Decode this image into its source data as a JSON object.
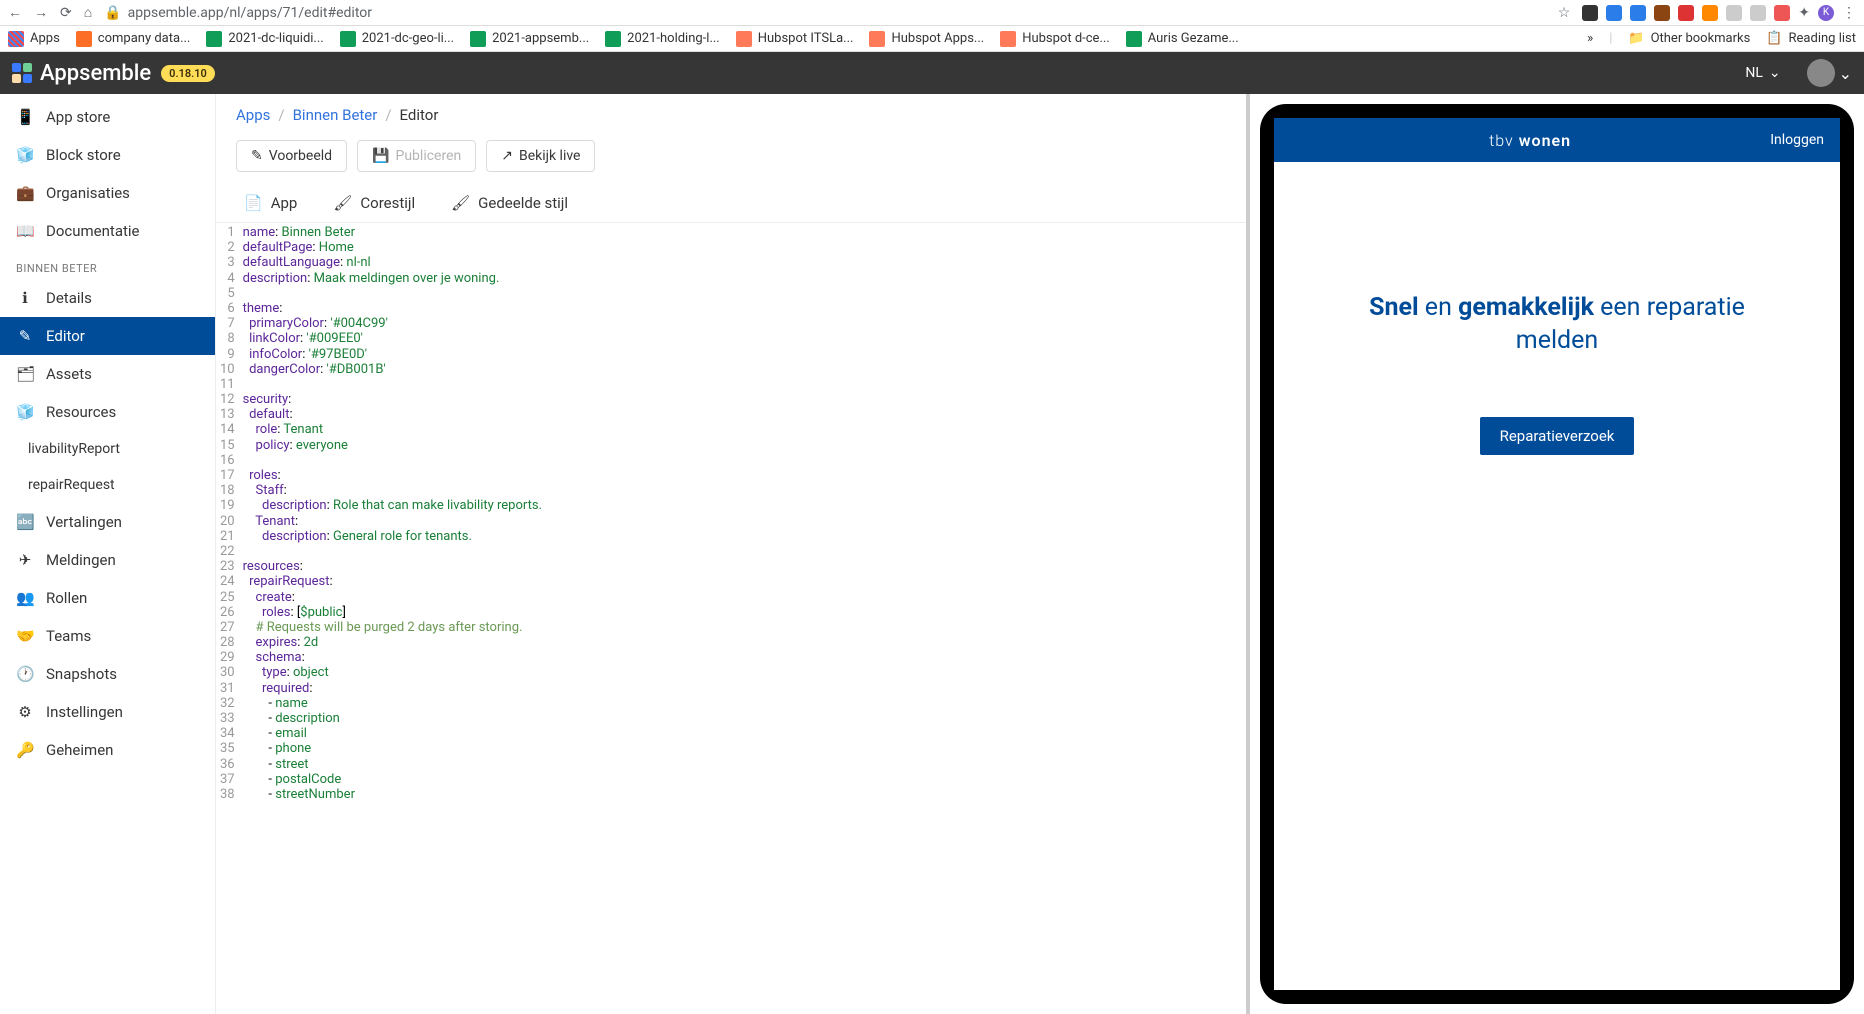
{
  "browser": {
    "url": "appsemble.app/nl/apps/71/edit#editor",
    "bookmarks": [
      "Apps",
      "company data...",
      "2021-dc-liquidi...",
      "2021-dc-geo-li...",
      "2021-appsemb...",
      "2021-holding-l...",
      "Hubspot ITSLa...",
      "Hubspot Apps...",
      "Hubspot d-ce...",
      "Auris Gezame..."
    ],
    "bookmarks_overflow": "»",
    "other_bookmarks": "Other bookmarks",
    "reading_list": "Reading list"
  },
  "header": {
    "brand": "Appsemble",
    "version": "0.18.10",
    "lang": "NL"
  },
  "sidebar": {
    "items": [
      {
        "label": "App store"
      },
      {
        "label": "Block store"
      },
      {
        "label": "Organisaties"
      },
      {
        "label": "Documentatie"
      }
    ],
    "section": "BINNEN BETER",
    "app_items": [
      {
        "label": "Details"
      },
      {
        "label": "Editor"
      },
      {
        "label": "Assets"
      },
      {
        "label": "Resources"
      }
    ],
    "resources": [
      "livabilityReport",
      "repairRequest"
    ],
    "more_items": [
      {
        "label": "Vertalingen"
      },
      {
        "label": "Meldingen"
      },
      {
        "label": "Rollen"
      },
      {
        "label": "Teams"
      },
      {
        "label": "Snapshots"
      },
      {
        "label": "Instellingen"
      },
      {
        "label": "Geheimen"
      }
    ]
  },
  "breadcrumb": {
    "apps": "Apps",
    "app": "Binnen Beter",
    "page": "Editor"
  },
  "toolbar": {
    "preview": "Voorbeeld",
    "publish": "Publiceren",
    "view_live": "Bekijk live"
  },
  "tabs": {
    "app": "App",
    "corestyle": "Corestijl",
    "sharedstyle": "Gedeelde stijl"
  },
  "code": {
    "lines": [
      {
        "n": 1,
        "t": "<span class='k-key'>name</span>: <span class='k-str'>Binnen Beter</span>"
      },
      {
        "n": 2,
        "t": "<span class='k-key'>defaultPage</span>: <span class='k-str'>Home</span>"
      },
      {
        "n": 3,
        "t": "<span class='k-key'>defaultLanguage</span>: <span class='k-str'>nl-nl</span>"
      },
      {
        "n": 4,
        "t": "<span class='k-key'>description</span>: <span class='k-str'>Maak meldingen over je woning.</span>"
      },
      {
        "n": 5,
        "t": ""
      },
      {
        "n": 6,
        "t": "<span class='k-key'>theme</span>:"
      },
      {
        "n": 7,
        "t": "  <span class='k-key'>primaryColor</span>: <span class='k-str'>'#004C99'</span>"
      },
      {
        "n": 8,
        "t": "  <span class='k-key'>linkColor</span>: <span class='k-str'>'#009EE0'</span>"
      },
      {
        "n": 9,
        "t": "  <span class='k-key'>infoColor</span>: <span class='k-str'>'#97BE0D'</span>"
      },
      {
        "n": 10,
        "t": "  <span class='k-key'>dangerColor</span>: <span class='k-str'>'#DB001B'</span>"
      },
      {
        "n": 11,
        "t": ""
      },
      {
        "n": 12,
        "t": "<span class='k-key'>security</span>:"
      },
      {
        "n": 13,
        "t": "  <span class='k-key'>default</span>:"
      },
      {
        "n": 14,
        "t": "    <span class='k-key'>role</span>: <span class='k-str'>Tenant</span>"
      },
      {
        "n": 15,
        "t": "    <span class='k-key'>policy</span>: <span class='k-str'>everyone</span>"
      },
      {
        "n": 16,
        "t": ""
      },
      {
        "n": 17,
        "t": "  <span class='k-key'>roles</span>:"
      },
      {
        "n": 18,
        "t": "    <span class='k-key'>Staff</span>:"
      },
      {
        "n": 19,
        "t": "      <span class='k-key'>description</span>: <span class='k-str'>Role that can make livability reports.</span>"
      },
      {
        "n": 20,
        "t": "    <span class='k-key'>Tenant</span>:"
      },
      {
        "n": 21,
        "t": "      <span class='k-key'>description</span>: <span class='k-str'>General role for tenants.</span>"
      },
      {
        "n": 22,
        "t": ""
      },
      {
        "n": 23,
        "t": "<span class='k-key'>resources</span>:"
      },
      {
        "n": 24,
        "t": "  <span class='k-key'>repairRequest</span>:"
      },
      {
        "n": 25,
        "t": "    <span class='k-key'>create</span>:"
      },
      {
        "n": 26,
        "t": "      <span class='k-key'>roles</span>: [<span class='k-str'>$public</span>]"
      },
      {
        "n": 27,
        "t": "    <span class='k-comment'># Requests will be purged 2 days after storing.</span>"
      },
      {
        "n": 28,
        "t": "    <span class='k-key'>expires</span>: <span class='k-str'>2d</span>"
      },
      {
        "n": 29,
        "t": "    <span class='k-key'>schema</span>:"
      },
      {
        "n": 30,
        "t": "      <span class='k-key'>type</span>: <span class='k-str'>object</span>"
      },
      {
        "n": 31,
        "t": "      <span class='k-key'>required</span>:"
      },
      {
        "n": 32,
        "t": "        - <span class='k-str'>name</span>"
      },
      {
        "n": 33,
        "t": "        - <span class='k-str'>description</span>"
      },
      {
        "n": 34,
        "t": "        - <span class='k-str'>email</span>"
      },
      {
        "n": 35,
        "t": "        - <span class='k-str'>phone</span>"
      },
      {
        "n": 36,
        "t": "        - <span class='k-str'>street</span>"
      },
      {
        "n": 37,
        "t": "        - <span class='k-str'>postalCode</span>"
      },
      {
        "n": 38,
        "t": "        - <span class='k-str'>streetNumber</span>"
      }
    ]
  },
  "preview": {
    "brand": "tbv wonen",
    "login": "Inloggen",
    "title_parts": [
      "Snel",
      " en ",
      "gemakkelijk",
      " een reparatie melden"
    ],
    "button": "Reparatieverzoek"
  }
}
